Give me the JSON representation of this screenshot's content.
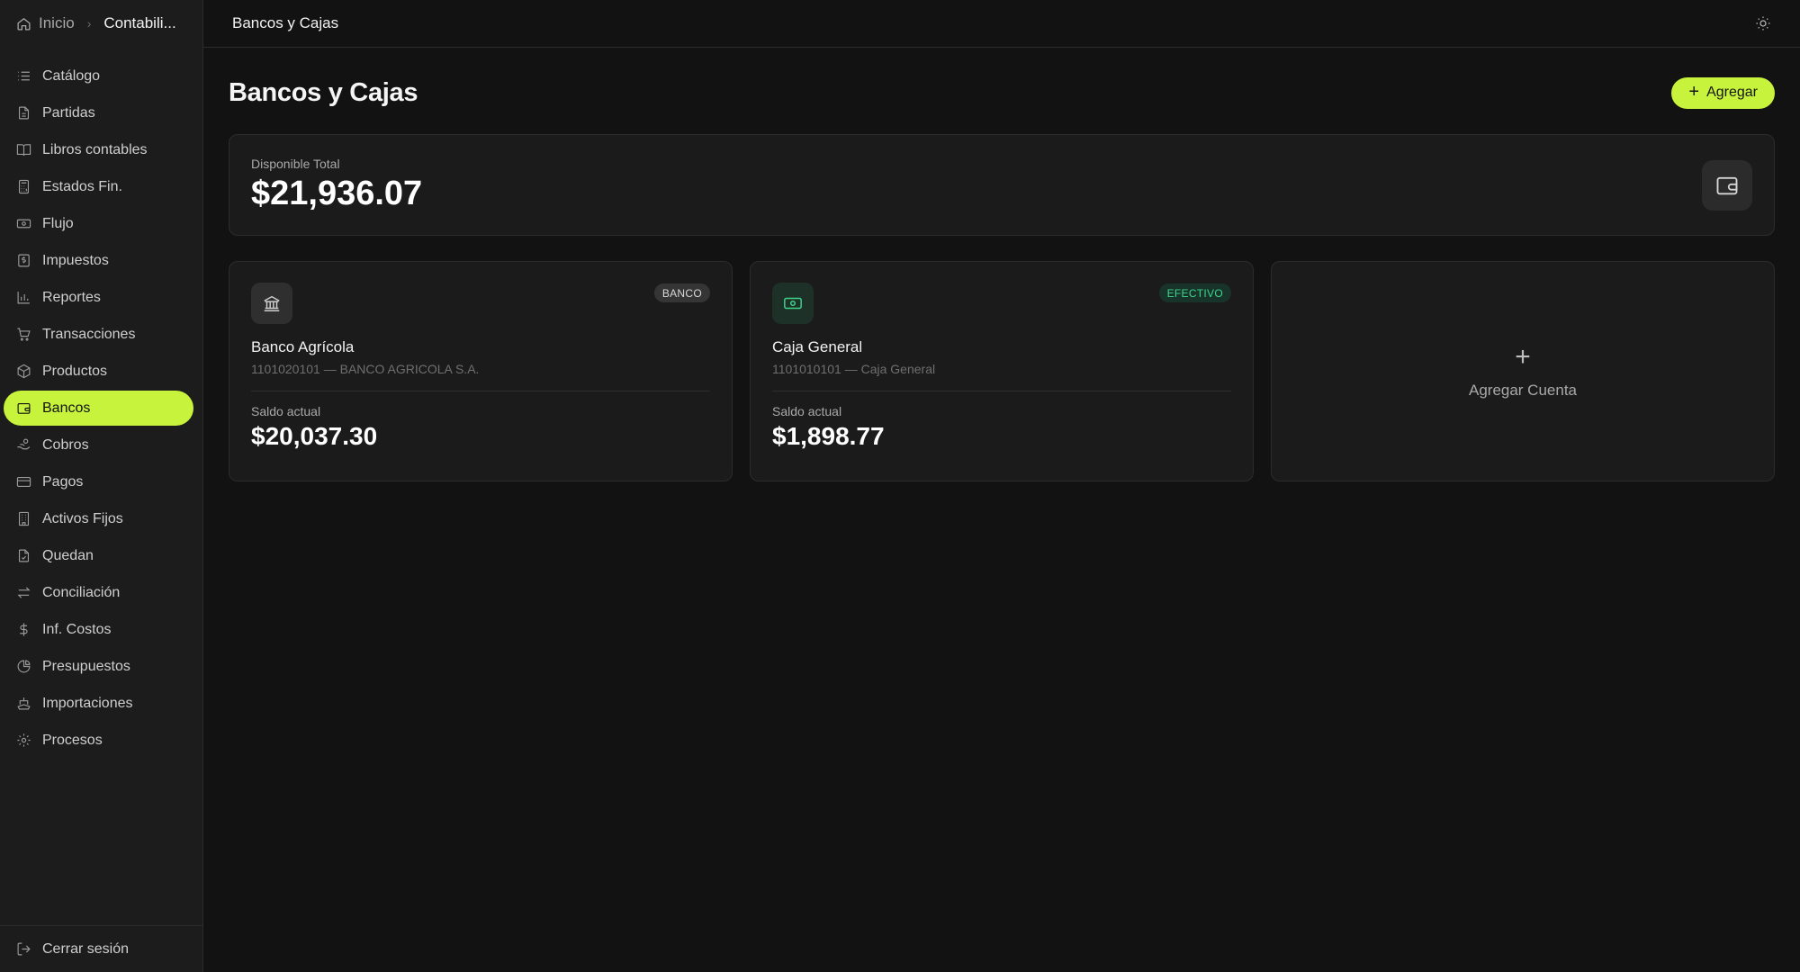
{
  "breadcrumb": {
    "home": "Inicio",
    "current": "Contabili..."
  },
  "sidebar": {
    "items": [
      {
        "label": "Catálogo",
        "icon": "list-icon"
      },
      {
        "label": "Partidas",
        "icon": "document-icon"
      },
      {
        "label": "Libros contables",
        "icon": "book-icon"
      },
      {
        "label": "Estados Fin.",
        "icon": "calculator-icon"
      },
      {
        "label": "Flujo",
        "icon": "money-icon"
      },
      {
        "label": "Impuestos",
        "icon": "receipt-icon"
      },
      {
        "label": "Reportes",
        "icon": "bar-chart-icon"
      },
      {
        "label": "Transacciones",
        "icon": "cart-icon"
      },
      {
        "label": "Productos",
        "icon": "box-icon"
      },
      {
        "label": "Bancos",
        "icon": "wallet-icon",
        "active": true
      },
      {
        "label": "Cobros",
        "icon": "hand-coins-icon"
      },
      {
        "label": "Pagos",
        "icon": "credit-card-icon"
      },
      {
        "label": "Activos Fijos",
        "icon": "building-icon"
      },
      {
        "label": "Quedan",
        "icon": "file-check-icon"
      },
      {
        "label": "Conciliación",
        "icon": "arrows-icon"
      },
      {
        "label": "Inf. Costos",
        "icon": "dollar-icon"
      },
      {
        "label": "Presupuestos",
        "icon": "pie-chart-icon"
      },
      {
        "label": "Importaciones",
        "icon": "ship-icon"
      },
      {
        "label": "Procesos",
        "icon": "cog-icon"
      }
    ],
    "logout": "Cerrar sesión"
  },
  "topbar": {
    "title": "Bancos y Cajas"
  },
  "page": {
    "title": "Bancos y Cajas",
    "add_label": "Agregar"
  },
  "total": {
    "label": "Disponible Total",
    "value": "$21,936.07"
  },
  "accounts": [
    {
      "type_badge": "BANCO",
      "name": "Banco Agrícola",
      "sub": "1101020101 — BANCO AGRICOLA S.A.",
      "saldo_label": "Saldo actual",
      "saldo": "$20,037.30"
    },
    {
      "type_badge": "EFECTIVO",
      "name": "Caja General",
      "sub": "1101010101 — Caja General",
      "saldo_label": "Saldo actual",
      "saldo": "$1,898.77"
    }
  ],
  "add_account": {
    "label": "Agregar Cuenta"
  },
  "colors": {
    "accent": "#c8f33c",
    "cash": "#3dd48a",
    "background": "#121212"
  }
}
